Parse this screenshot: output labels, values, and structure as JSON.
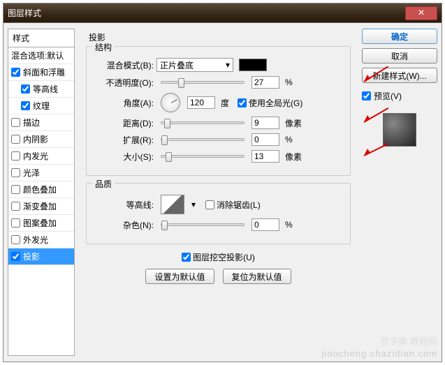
{
  "title": "图层样式",
  "styles_header": "样式",
  "blend_default": "混合选项:默认",
  "style_items": [
    {
      "label": "斜面和浮雕",
      "checked": true,
      "indent": false
    },
    {
      "label": "等高线",
      "checked": true,
      "indent": true
    },
    {
      "label": "纹理",
      "checked": true,
      "indent": true
    },
    {
      "label": "描边",
      "checked": false,
      "indent": false
    },
    {
      "label": "内阴影",
      "checked": false,
      "indent": false
    },
    {
      "label": "内发光",
      "checked": false,
      "indent": false
    },
    {
      "label": "光泽",
      "checked": false,
      "indent": false
    },
    {
      "label": "颜色叠加",
      "checked": false,
      "indent": false
    },
    {
      "label": "渐变叠加",
      "checked": false,
      "indent": false
    },
    {
      "label": "图案叠加",
      "checked": false,
      "indent": false
    },
    {
      "label": "外发光",
      "checked": false,
      "indent": false
    },
    {
      "label": "投影",
      "checked": true,
      "indent": false,
      "selected": true
    }
  ],
  "main_title": "投影",
  "structure": {
    "title": "结构",
    "blend_mode_label": "混合模式(B):",
    "blend_mode_value": "正片叠底",
    "opacity_label": "不透明度(O):",
    "opacity_value": "27",
    "opacity_unit": "%",
    "angle_label": "角度(A):",
    "angle_value": "120",
    "angle_unit": "度",
    "global_light_label": "使用全局光(G)",
    "distance_label": "距离(D):",
    "distance_value": "9",
    "distance_unit": "像素",
    "spread_label": "扩展(R):",
    "spread_value": "0",
    "spread_unit": "%",
    "size_label": "大小(S):",
    "size_value": "13",
    "size_unit": "像素"
  },
  "quality": {
    "title": "品质",
    "contour_label": "等高线:",
    "antialias_label": "消除锯齿(L)",
    "noise_label": "杂色(N):",
    "noise_value": "0",
    "noise_unit": "%"
  },
  "knockout_label": "图层挖空投影(U)",
  "set_default": "设置为默认值",
  "reset_default": "复位为默认值",
  "ok": "确定",
  "cancel": "取消",
  "new_style": "新建样式(W)...",
  "preview_label": "预览(V)",
  "wm2": "哲字典 教程网",
  "wm1": "jiaocheng.chazidian.com"
}
